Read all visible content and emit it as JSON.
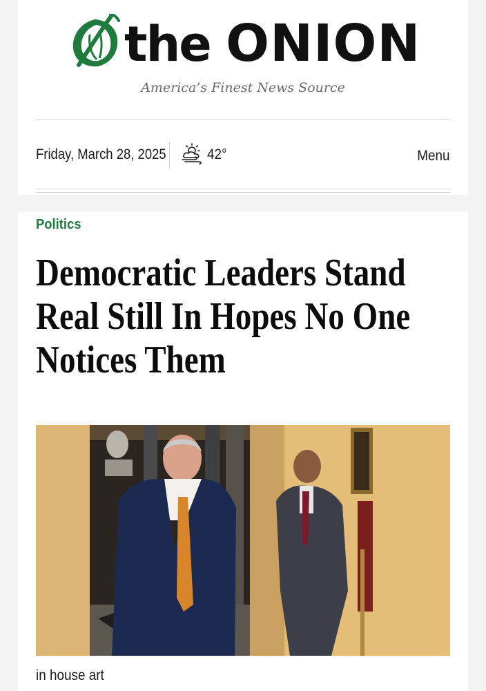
{
  "header": {
    "logo_prefix": "the",
    "logo_main": "ONION",
    "tagline": "America’s Finest News Source",
    "date": "Friday, March 28, 2025",
    "weather_icon": "partly-cloudy-wind-icon",
    "temperature": "42°",
    "menu_label": "Menu",
    "brand_green": "#1f7a3e"
  },
  "article": {
    "category": "Politics",
    "headline": "Democratic Leaders Stand Real Still In Hopes No One Notices Them",
    "image_caption": "in house art",
    "category_color": "#1f7a3e"
  }
}
